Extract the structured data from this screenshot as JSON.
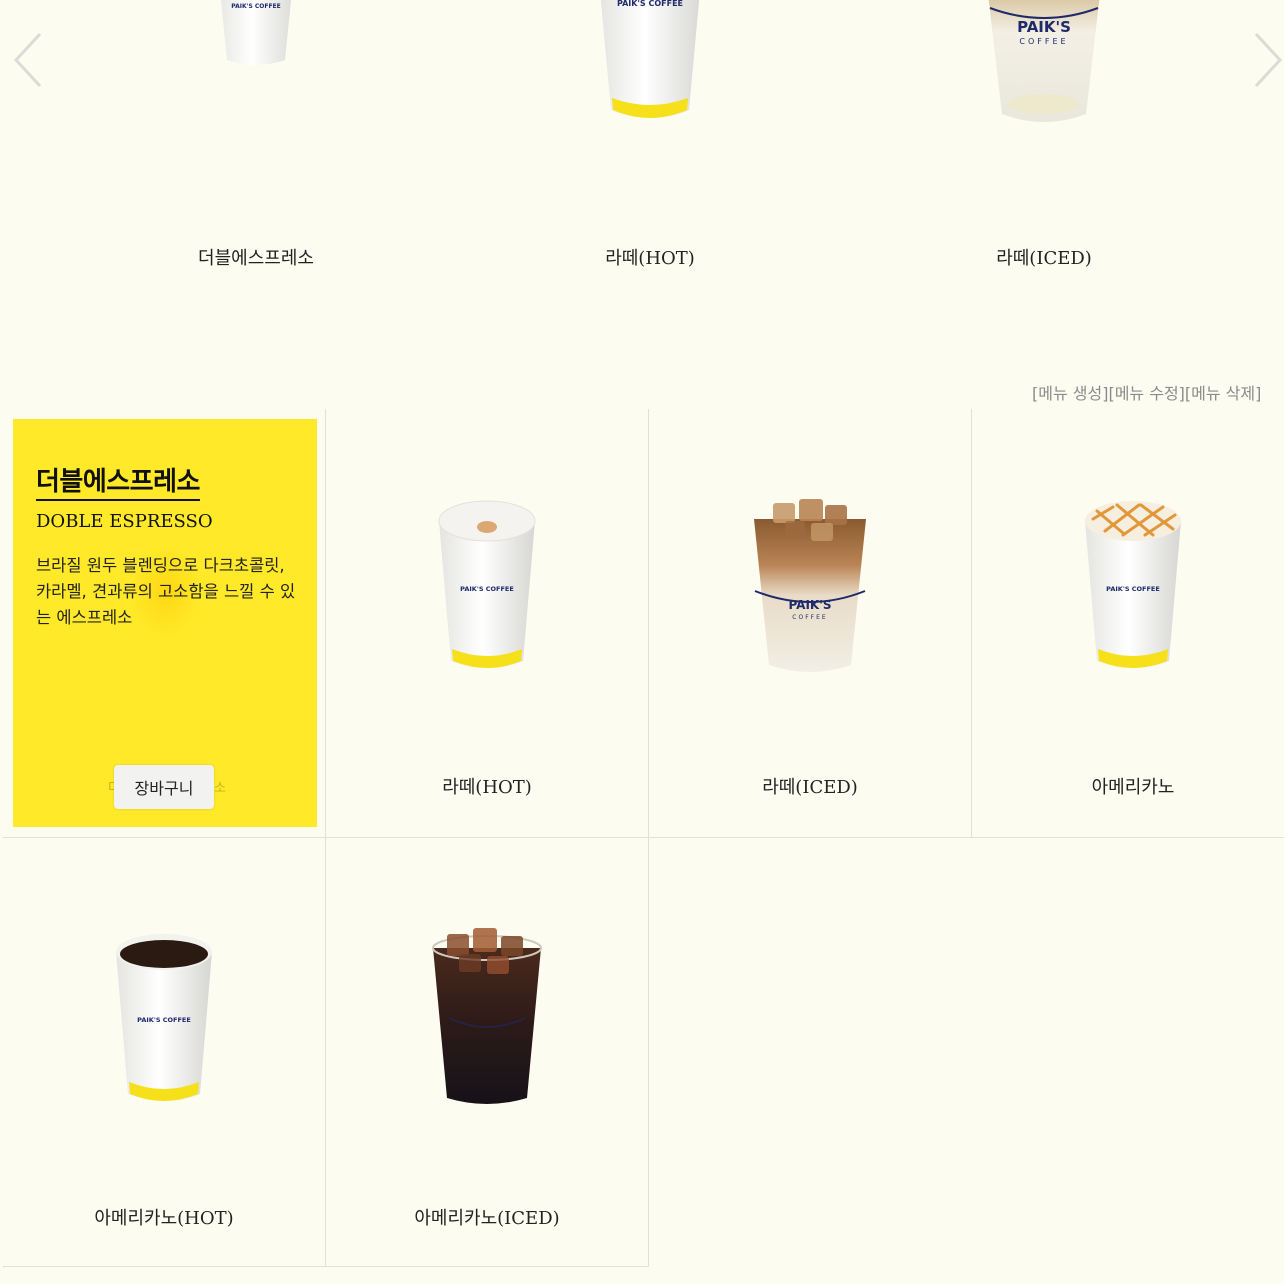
{
  "carousel": {
    "slides": [
      {
        "label": "더블에스프레소",
        "cup": "hot-cup",
        "cup_brand": "PAIK'S COFFEE"
      },
      {
        "label": "라떼(HOT)",
        "cup": "hot-cup",
        "cup_brand": "PAIK'S COFFEE"
      },
      {
        "label": "라떼(ICED)",
        "cup": "iced-latte-cup",
        "cup_brand": "PAIK'S",
        "cup_brand_sub": "COFFEE"
      }
    ],
    "prev_icon": "chevron-left-icon",
    "next_icon": "chevron-right-icon"
  },
  "admin": {
    "create": "[메뉴 생성]",
    "edit": "[메뉴 수정]",
    "delete": "[메뉴 삭제]"
  },
  "detail": {
    "title_kr": "더블에스프레소",
    "title_en": "DOBLE ESPRESSO",
    "description": "브라질 원두 블렌딩으로 다크초콜릿, 카라멜, 견과류의 고소함을 느낄 수 있는 에스프레소",
    "cart_label": "장바구니",
    "ghost_left": "더",
    "ghost_right": "소"
  },
  "menu": [
    {
      "name": "라떼(HOT)",
      "cup": "latte-hot-cup",
      "cup_brand": "PAIK'S COFFEE"
    },
    {
      "name": "라떼(ICED)",
      "cup": "iced-latte-cup",
      "cup_brand": "PAIK'S",
      "cup_brand_sub": "COFFEE"
    },
    {
      "name": "아메리카노",
      "cup": "caramel-cup",
      "cup_brand": "PAIK'S COFFEE"
    },
    {
      "name": "아메리카노(HOT)",
      "cup": "americano-hot-cup",
      "cup_brand": "PAIK'S COFFEE"
    },
    {
      "name": "아메리카노(ICED)",
      "cup": "americano-iced-cup"
    }
  ],
  "colors": {
    "background": "#fdfcf1",
    "accent_yellow": "#ffe928",
    "cup_band": "#f5e01a",
    "brand_navy": "#1f2a6b"
  }
}
